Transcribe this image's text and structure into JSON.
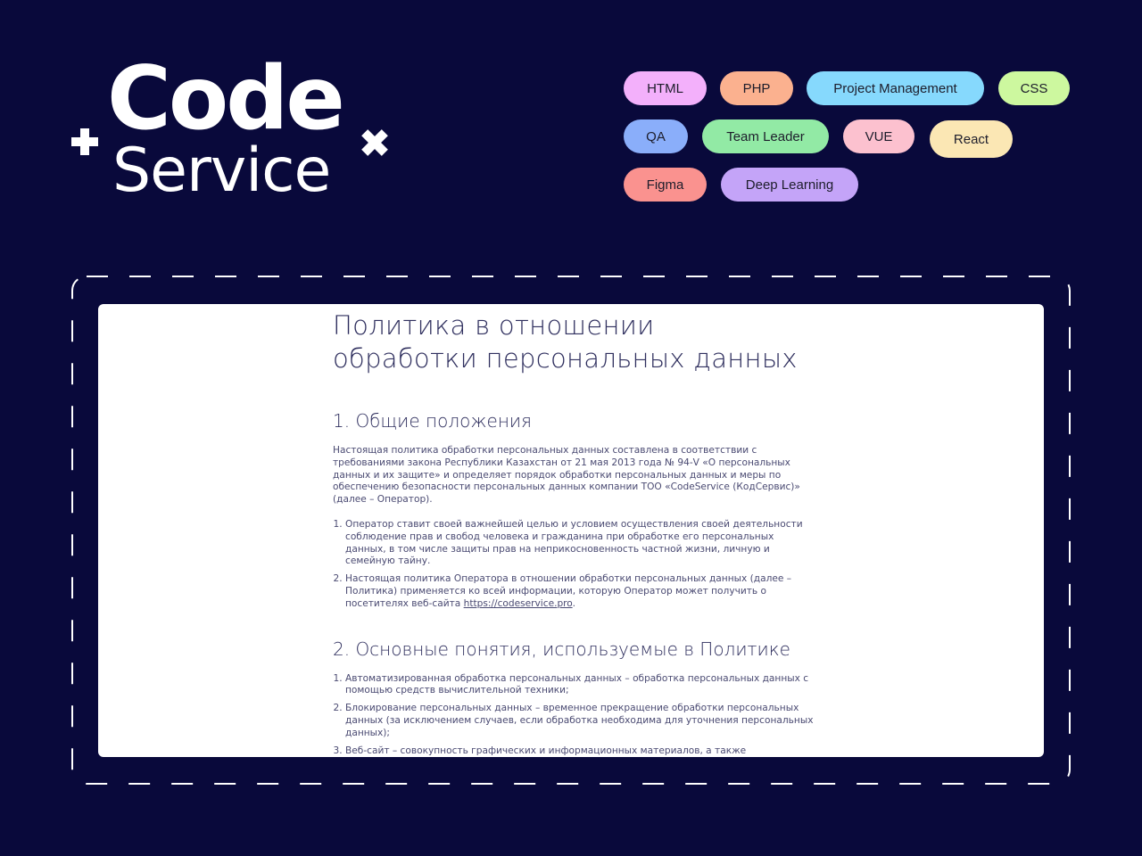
{
  "logo": {
    "line1": "Code",
    "line2": "Service"
  },
  "tags": [
    {
      "label": "HTML",
      "color": "#f3b0fb"
    },
    {
      "label": "PHP",
      "color": "#fbb18f"
    },
    {
      "label": "Project Management",
      "color": "#86d9fd"
    },
    {
      "label": "CSS",
      "color": "#cdf89f"
    },
    {
      "label": "QA",
      "color": "#8aaefa"
    },
    {
      "label": "Team Leader",
      "color": "#92eaa5"
    },
    {
      "label": "VUE",
      "color": "#fcc1cf"
    },
    {
      "label": "React",
      "color": "#fbe7b4"
    },
    {
      "label": "Figma",
      "color": "#fa928f"
    },
    {
      "label": "Deep Learning",
      "color": "#c4a4f8"
    }
  ],
  "document": {
    "title_line1": "Политика в отношении",
    "title_line2": "обработки персональных данных",
    "section1": {
      "heading": "1. Общие положения",
      "intro": "Настоящая политика обработки персональных данных составлена в соответствии с требованиями закона Республики Казахстан от 21 мая 2013 года № 94-V «О персональных данных и их защите» и определяет порядок обработки персональных данных и меры по обеспечению безопасности персональных данных компании ТОО «CodeService (КодСервис)» (далее – Оператор).",
      "item1": "Оператор ставит своей важнейшей целью и условием осуществления своей деятельности соблюдение прав и свобод человека и гражданина при обработке его персональных данных, в том числе защиты прав на неприкосновенность частной жизни, личную и семейную тайну.",
      "item2_text": "Настоящая политика Оператора в отношении обработки персональных данных (далее – Политика) применяется ко всей информации, которую Оператор может получить о посетителях веб-сайта ",
      "item2_link": "https://codeservice.pro",
      "item2_end": "."
    },
    "section2": {
      "heading": "2. Основные понятия, используемые в Политике",
      "items": [
        "Автоматизированная обработка персональных данных – обработка персональных данных с помощью средств вычислительной техники;",
        "Блокирование персональных данных – временное прекращение обработки персональных данных (за исключением случаев, если обработка необходима для уточнения персональных данных);",
        "Веб-сайт – совокупность графических и информационных материалов, а также"
      ]
    }
  }
}
